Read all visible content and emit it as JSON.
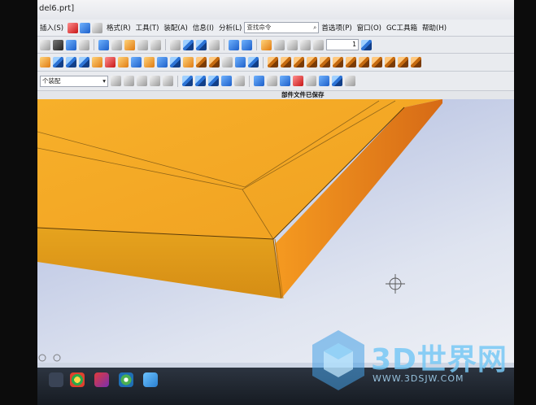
{
  "window": {
    "title": "del6.prt]"
  },
  "menu": {
    "items": [
      "插入(S)",
      "格式(R)",
      "工具(T)",
      "装配(A)",
      "信息(I)",
      "分析(L)",
      "首选项(P)",
      "窗口(O)",
      "GC工具箱",
      "帮助(H)"
    ]
  },
  "search": {
    "placeholder": "查找命令"
  },
  "filter_dropdown": {
    "value": "个装配"
  },
  "small_select": {
    "value": "1"
  },
  "status": {
    "text": "部件文件已保存"
  },
  "watermark": {
    "brand": "3D世界网",
    "url": "WWW.3DSJW.COM"
  },
  "colors": {
    "model_top": "#f2a322",
    "model_side": "#d98f17",
    "model_edge": "#e2701a",
    "viewport_bg": "#c3cce6"
  }
}
